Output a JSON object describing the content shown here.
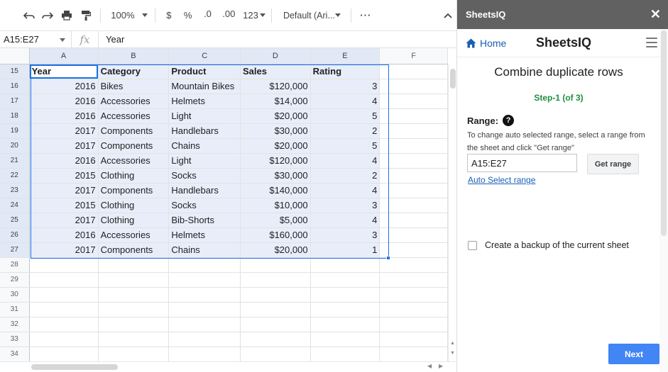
{
  "toolbar": {
    "zoom": "100%",
    "currency": "$",
    "percent": "%",
    "decrease_decimal": ".0",
    "increase_decimal": ".00",
    "number_format": "123",
    "font": "Default (Ari..."
  },
  "formula_bar": {
    "name_box": "A15:E27",
    "fx": "fx",
    "content": "Year"
  },
  "sheet": {
    "columns": [
      "A",
      "B",
      "C",
      "D",
      "E",
      "F"
    ],
    "rows": [
      {
        "num": "15",
        "cells": [
          "Year",
          "Category",
          "Product",
          "Sales",
          "Rating",
          ""
        ]
      },
      {
        "num": "16",
        "cells": [
          "2016",
          "Bikes",
          "Mountain Bikes",
          "$120,000",
          "3",
          ""
        ]
      },
      {
        "num": "17",
        "cells": [
          "2016",
          "Accessories",
          "Helmets",
          "$14,000",
          "4",
          ""
        ]
      },
      {
        "num": "18",
        "cells": [
          "2016",
          "Accessories",
          "Light",
          "$20,000",
          "5",
          ""
        ]
      },
      {
        "num": "19",
        "cells": [
          "2017",
          "Components",
          "Handlebars",
          "$30,000",
          "2",
          ""
        ]
      },
      {
        "num": "20",
        "cells": [
          "2017",
          "Components",
          "Chains",
          "$20,000",
          "5",
          ""
        ]
      },
      {
        "num": "21",
        "cells": [
          "2016",
          "Accessories",
          "Light",
          "$120,000",
          "4",
          ""
        ]
      },
      {
        "num": "22",
        "cells": [
          "2015",
          "Clothing",
          "Socks",
          "$30,000",
          "2",
          ""
        ]
      },
      {
        "num": "23",
        "cells": [
          "2017",
          "Components",
          "Handlebars",
          "$140,000",
          "4",
          ""
        ]
      },
      {
        "num": "24",
        "cells": [
          "2015",
          "Clothing",
          "Socks",
          "$10,000",
          "3",
          ""
        ]
      },
      {
        "num": "25",
        "cells": [
          "2017",
          "Clothing",
          "Bib-Shorts",
          "$5,000",
          "4",
          ""
        ]
      },
      {
        "num": "26",
        "cells": [
          "2016",
          "Accessories",
          "Helmets",
          "$160,000",
          "3",
          ""
        ]
      },
      {
        "num": "27",
        "cells": [
          "2017",
          "Components",
          "Chains",
          "$20,000",
          "1",
          ""
        ]
      },
      {
        "num": "28",
        "cells": [
          "",
          "",
          "",
          "",
          "",
          ""
        ]
      },
      {
        "num": "29",
        "cells": [
          "",
          "",
          "",
          "",
          "",
          ""
        ]
      },
      {
        "num": "30",
        "cells": [
          "",
          "",
          "",
          "",
          "",
          ""
        ]
      },
      {
        "num": "31",
        "cells": [
          "",
          "",
          "",
          "",
          "",
          ""
        ]
      },
      {
        "num": "32",
        "cells": [
          "",
          "",
          "",
          "",
          "",
          ""
        ]
      },
      {
        "num": "33",
        "cells": [
          "",
          "",
          "",
          "",
          "",
          ""
        ]
      },
      {
        "num": "34",
        "cells": [
          "",
          "",
          "",
          "",
          "",
          ""
        ]
      }
    ]
  },
  "panel": {
    "title": "SheetsIQ",
    "close": "✕",
    "home": "Home",
    "brand": "SheetsIQ",
    "step_title": "Combine duplicate rows",
    "step_label": "Step-1 (of 3)",
    "range_label": "Range:",
    "help": "?",
    "range_help": "To change auto selected range, select a range from the sheet and click \"Get range\"",
    "range_value": "A15:E27",
    "get_range": "Get range",
    "auto_select": "Auto Select range",
    "backup_label": "Create a backup of the current sheet",
    "next": "Next",
    "accent": "#4285f4",
    "step_color": "#1e8e3e",
    "header_bg": "#616161"
  }
}
